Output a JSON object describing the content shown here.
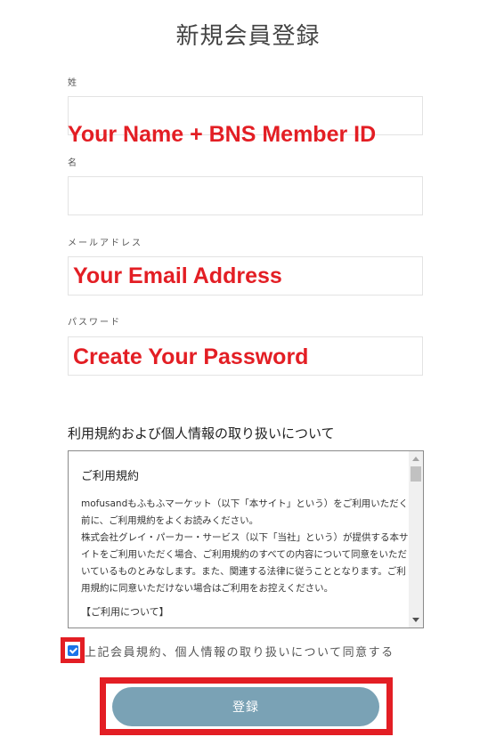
{
  "page": {
    "title": "新規会員登録"
  },
  "form": {
    "fields": [
      {
        "label": "姓",
        "value": "",
        "placeholder": ""
      },
      {
        "label": "名",
        "value": "",
        "placeholder": ""
      },
      {
        "label": "メールアドレス",
        "value": "",
        "placeholder": ""
      },
      {
        "label": "パスワード",
        "value": "",
        "placeholder": ""
      }
    ]
  },
  "annotations": {
    "name": "Your Name + BNS Member ID",
    "email": "Your Email Address",
    "password": "Create Your Password",
    "color": "#e31e24"
  },
  "terms": {
    "section_title": "利用規約および個人情報の取り扱いについて",
    "heading": "ご利用規約",
    "paragraphs": [
      "mofusandもふもふマーケット（以下「本サイト」という）をご利用いただく前に、ご利用規約をよくお読みください。",
      "株式会社グレイ・パーカー・サービス（以下「当社」という）が提供する本サイトをご利用いただく場合、ご利用規約のすべての内容について同意をいただいているものとみなします。また、関連する法律に従うこととなります。ご利用規約に同意いただけない場合はご利用をお控えください。"
    ],
    "subheading": "【ご利用について】"
  },
  "agreement": {
    "label": "上記会員規約、個人情報の取り扱いについて同意する",
    "checked": true
  },
  "submit": {
    "label": "登録",
    "color": "#7aa2b5"
  }
}
